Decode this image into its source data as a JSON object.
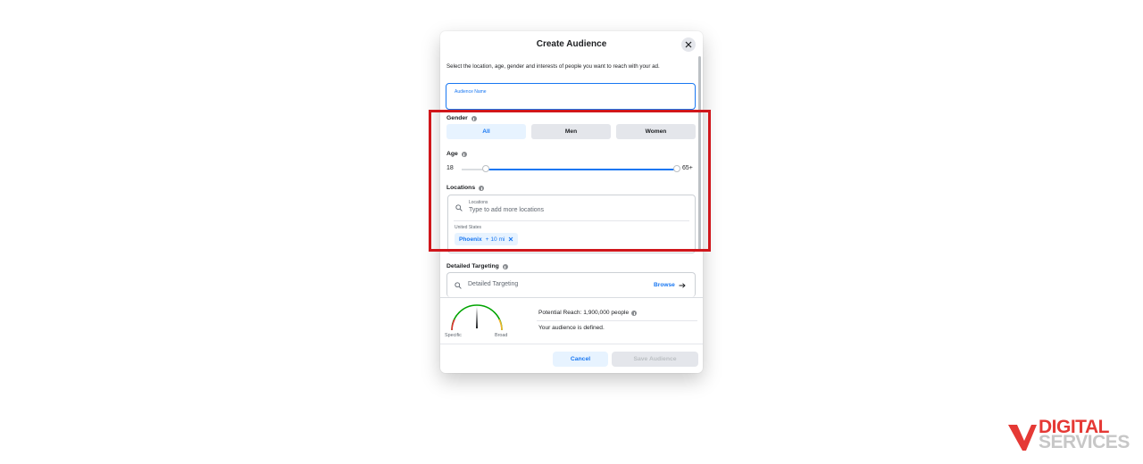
{
  "dialog": {
    "title": "Create Audience",
    "intro": "Select the location, age, gender and interests of people you want to reach with your ad.",
    "audience_name_label": "Audience Name",
    "gender": {
      "label": "Gender",
      "options": [
        "All",
        "Men",
        "Women"
      ],
      "selected": "All"
    },
    "age": {
      "label": "Age",
      "min": "18",
      "max": "65+"
    },
    "locations": {
      "label": "Locations",
      "search_label": "Locations",
      "search_placeholder": "Type to add more locations",
      "country": "United States",
      "chip_city": "Phoenix",
      "chip_radius": "+ 10 mi"
    },
    "detailed_targeting": {
      "label": "Detailed Targeting",
      "placeholder": "Detailed Targeting",
      "browse": "Browse"
    },
    "gauge": {
      "left_label": "Specific",
      "right_label": "Broad"
    },
    "reach": {
      "text": "Potential Reach: 1,900,000 people",
      "status": "Your audience is defined."
    },
    "buttons": {
      "cancel": "Cancel",
      "save": "Save Audience"
    }
  },
  "logo": {
    "line1": "DIGITAL",
    "line2": "SERVICES"
  },
  "colors": {
    "accent": "#1877f2",
    "highlight": "#d0161b",
    "logo_red": "#e53935"
  }
}
